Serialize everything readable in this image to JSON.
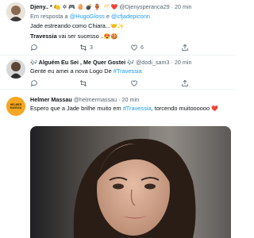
{
  "tweets": [
    {
      "name": "Djeny.. *",
      "name_emojis": "🍋 ✡ 🎮 🥚 💣 🏺 🥂 ❤️",
      "handle": "@Djenysperanca29",
      "time": "· 20 min",
      "reply_prefix": "Em resposta a",
      "reply_to_1": "@HugoGloss",
      "reply_and": "e",
      "reply_to_2": "@cfjadepiconn",
      "line1": "Jade estreando como Chiara...",
      "line1_emoji": "🤝✨",
      "line2_bold": "Travessia",
      "line2_rest": "vai ser sucesso ..",
      "line2_emoji": "😍🍪",
      "replies": "",
      "retweets": "3",
      "likes": "6"
    },
    {
      "name": "🎶 Alguém Eu Sei , Me Quer Gostei 🎶",
      "handle": "@dodi_sam3",
      "time": "· 20 min",
      "text_prefix": "Gente eu amei a nova Logo De",
      "text_hashtag": "#Travessia",
      "replies": "",
      "retweets": "",
      "likes": ""
    },
    {
      "name": "Helmer Massau",
      "handle": "@helmermassau",
      "time": "· 20 min",
      "avatar_label": "HELMER MASSAU",
      "text_prefix": "Espero que a Jade brilhe muito em",
      "text_hashtag": "#Travessia",
      "text_suffix": ", torcendo muitoooooo",
      "text_emoji": "❤️"
    }
  ],
  "icons": [
    "reply-icon",
    "retweet-icon",
    "like-icon",
    "share-icon"
  ],
  "colors": {
    "link": "#1d9bf0",
    "muted": "#536471",
    "text": "#0f1419",
    "helmer_avatar": "#f5a623"
  }
}
